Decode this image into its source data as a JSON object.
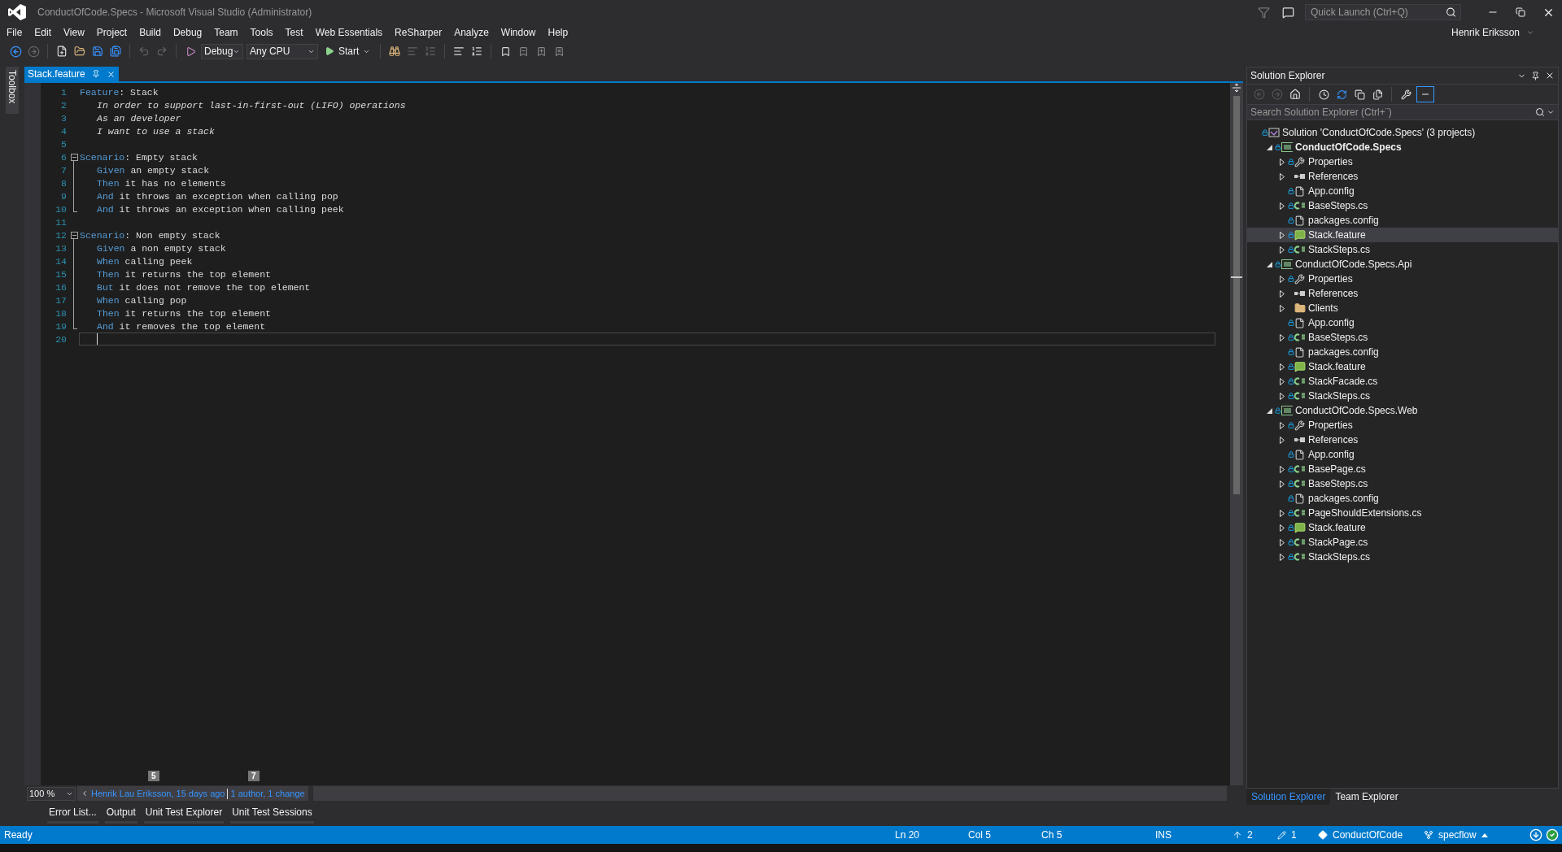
{
  "window": {
    "title": "ConductOfCode.Specs - Microsoft Visual Studio (Administrator)",
    "quick_launch": {
      "placeholder": "Quick Launch (Ctrl+Q)"
    },
    "user": "Henrik Eriksson"
  },
  "menu": [
    "File",
    "Edit",
    "View",
    "Project",
    "Build",
    "Debug",
    "Team",
    "Tools",
    "Test",
    "Web Essentials",
    "ReSharper",
    "Analyze",
    "Window",
    "Help"
  ],
  "toolbar": {
    "configuration": "Debug",
    "platform": "Any CPU",
    "start": "Start"
  },
  "toolbox_label": "Toolbox",
  "document_tabs": [
    {
      "label": "Stack.feature",
      "selected": true
    }
  ],
  "editor": {
    "blocks": [
      {
        "kind": "plain",
        "lines": [
          {
            "number": "1",
            "kind": "header",
            "current": false,
            "tokens": [
              {
                "kind": "keyword",
                "text": "Feature"
              },
              {
                "kind": "plain",
                "text": ": Stack"
              }
            ]
          },
          {
            "number": "2",
            "kind": "step",
            "current": false,
            "tokens": [
              {
                "kind": "description",
                "text": "In order to support last-in-first-out (LIFO) operations"
              }
            ]
          },
          {
            "number": "3",
            "kind": "step",
            "current": false,
            "tokens": [
              {
                "kind": "description",
                "text": "As an developer"
              }
            ]
          },
          {
            "number": "4",
            "kind": "step",
            "current": false,
            "tokens": [
              {
                "kind": "description",
                "text": "I want to use a stack"
              }
            ]
          },
          {
            "number": "5",
            "kind": "blank",
            "current": false
          }
        ]
      },
      {
        "kind": "scenario",
        "expanded": true,
        "lines": [
          {
            "number": "6",
            "kind": "header",
            "current": false,
            "tokens": [
              {
                "kind": "keyword",
                "text": "Scenario"
              },
              {
                "kind": "plain",
                "text": ": Empty stack"
              }
            ]
          },
          {
            "number": "7",
            "kind": "step",
            "current": false,
            "tokens": [
              {
                "kind": "keyword",
                "text": "Given"
              },
              {
                "kind": "plain",
                "text": " an empty stack"
              }
            ]
          },
          {
            "number": "8",
            "kind": "step",
            "current": false,
            "tokens": [
              {
                "kind": "keyword",
                "text": "Then"
              },
              {
                "kind": "plain",
                "text": " it has no elements"
              }
            ]
          },
          {
            "number": "9",
            "kind": "step",
            "current": false,
            "tokens": [
              {
                "kind": "keyword",
                "text": "And"
              },
              {
                "kind": "plain",
                "text": " it throws an exception when calling pop"
              }
            ]
          },
          {
            "number": "10",
            "kind": "step",
            "current": false,
            "tokens": [
              {
                "kind": "keyword",
                "text": "And"
              },
              {
                "kind": "plain",
                "text": " it throws an exception when calling peek"
              }
            ]
          }
        ]
      },
      {
        "kind": "plain",
        "lines": [
          {
            "number": "11",
            "kind": "blank",
            "current": false
          }
        ]
      },
      {
        "kind": "scenario",
        "expanded": true,
        "lines": [
          {
            "number": "12",
            "kind": "header",
            "current": false,
            "tokens": [
              {
                "kind": "keyword",
                "text": "Scenario"
              },
              {
                "kind": "plain",
                "text": ": Non empty stack"
              }
            ]
          },
          {
            "number": "13",
            "kind": "step",
            "current": false,
            "tokens": [
              {
                "kind": "keyword",
                "text": "Given"
              },
              {
                "kind": "plain",
                "text": " a non empty stack"
              }
            ]
          },
          {
            "number": "14",
            "kind": "step",
            "current": false,
            "tokens": [
              {
                "kind": "keyword",
                "text": "When"
              },
              {
                "kind": "plain",
                "text": " calling peek"
              }
            ]
          },
          {
            "number": "15",
            "kind": "step",
            "current": false,
            "tokens": [
              {
                "kind": "keyword",
                "text": "Then"
              },
              {
                "kind": "plain",
                "text": " it returns the top element"
              }
            ]
          },
          {
            "number": "16",
            "kind": "step",
            "current": false,
            "tokens": [
              {
                "kind": "keyword",
                "text": "But"
              },
              {
                "kind": "plain",
                "text": " it does not remove the top element"
              }
            ]
          },
          {
            "number": "17",
            "kind": "step",
            "current": false,
            "tokens": [
              {
                "kind": "keyword",
                "text": "When"
              },
              {
                "kind": "plain",
                "text": " calling pop"
              }
            ]
          },
          {
            "number": "18",
            "kind": "step",
            "current": false,
            "tokens": [
              {
                "kind": "keyword",
                "text": "Then"
              },
              {
                "kind": "plain",
                "text": " it returns the top element"
              }
            ]
          },
          {
            "number": "19",
            "kind": "step",
            "current": false,
            "tokens": [
              {
                "kind": "keyword",
                "text": "And"
              },
              {
                "kind": "plain",
                "text": " it removes the top element"
              }
            ]
          }
        ]
      },
      {
        "kind": "plain",
        "lines": [
          {
            "number": "20",
            "kind": "step",
            "current": true
          }
        ]
      }
    ],
    "zoom": "100 %",
    "codelens": {
      "author": "Henrik Lau Eriksson, 15 days ago",
      "changes": "1 author, 1 change",
      "keytips": [
        "5",
        "7"
      ]
    }
  },
  "tool_tabs": [
    "Error List...",
    "Output",
    "Unit Test Explorer",
    "Unit Test Sessions"
  ],
  "solution_explorer": {
    "title": "Solution Explorer",
    "search": {
      "placeholder": "Search Solution Explorer (Ctrl+¨)"
    },
    "tree": [
      {
        "label": "Solution 'ConductOfCode.Specs' (3 projects)",
        "kind": "solution",
        "locked": true,
        "startup": false,
        "selected": false,
        "children": [
          {
            "label": "ConductOfCode.Specs",
            "kind": "project",
            "expanded": true,
            "locked": true,
            "startup": true,
            "selected": false,
            "children": [
              {
                "label": "Properties",
                "kind": "properties",
                "expanded": false,
                "locked": true,
                "startup": false,
                "selected": false
              },
              {
                "label": "References",
                "kind": "references",
                "expanded": false,
                "locked": false,
                "startup": false,
                "selected": false
              },
              {
                "label": "App.config",
                "kind": "config",
                "locked": true,
                "startup": false,
                "selected": false
              },
              {
                "label": "BaseSteps.cs",
                "kind": "csharp",
                "expanded": false,
                "locked": true,
                "startup": false,
                "selected": false
              },
              {
                "label": "packages.config",
                "kind": "config",
                "locked": true,
                "startup": false,
                "selected": false
              },
              {
                "label": "Stack.feature",
                "kind": "feature",
                "expanded": false,
                "locked": true,
                "startup": false,
                "selected": true
              },
              {
                "label": "StackSteps.cs",
                "kind": "csharp",
                "expanded": false,
                "locked": true,
                "startup": false,
                "selected": false
              }
            ]
          },
          {
            "label": "ConductOfCode.Specs.Api",
            "kind": "project",
            "expanded": true,
            "locked": true,
            "startup": false,
            "selected": false,
            "children": [
              {
                "label": "Properties",
                "kind": "properties",
                "expanded": false,
                "locked": true,
                "startup": false,
                "selected": false
              },
              {
                "label": "References",
                "kind": "references",
                "expanded": false,
                "locked": false,
                "startup": false,
                "selected": false
              },
              {
                "label": "Clients",
                "kind": "folder",
                "expanded": false,
                "locked": false,
                "startup": false,
                "selected": false
              },
              {
                "label": "App.config",
                "kind": "config",
                "locked": true,
                "startup": false,
                "selected": false
              },
              {
                "label": "BaseSteps.cs",
                "kind": "csharp",
                "expanded": false,
                "locked": true,
                "startup": false,
                "selected": false
              },
              {
                "label": "packages.config",
                "kind": "config",
                "locked": true,
                "startup": false,
                "selected": false
              },
              {
                "label": "Stack.feature",
                "kind": "feature",
                "expanded": false,
                "locked": true,
                "startup": false,
                "selected": false
              },
              {
                "label": "StackFacade.cs",
                "kind": "csharp",
                "expanded": false,
                "locked": true,
                "startup": false,
                "selected": false
              },
              {
                "label": "StackSteps.cs",
                "kind": "csharp",
                "expanded": false,
                "locked": true,
                "startup": false,
                "selected": false
              }
            ]
          },
          {
            "label": "ConductOfCode.Specs.Web",
            "kind": "project",
            "expanded": true,
            "locked": true,
            "startup": false,
            "selected": false,
            "children": [
              {
                "label": "Properties",
                "kind": "properties",
                "expanded": false,
                "locked": true,
                "startup": false,
                "selected": false
              },
              {
                "label": "References",
                "kind": "references",
                "expanded": false,
                "locked": false,
                "startup": false,
                "selected": false
              },
              {
                "label": "App.config",
                "kind": "config",
                "locked": true,
                "startup": false,
                "selected": false
              },
              {
                "label": "BasePage.cs",
                "kind": "csharp",
                "expanded": false,
                "locked": true,
                "startup": false,
                "selected": false
              },
              {
                "label": "BaseSteps.cs",
                "kind": "csharp",
                "expanded": false,
                "locked": true,
                "startup": false,
                "selected": false
              },
              {
                "label": "packages.config",
                "kind": "config",
                "locked": true,
                "startup": false,
                "selected": false
              },
              {
                "label": "PageShouldExtensions.cs",
                "kind": "csharp",
                "expanded": false,
                "locked": true,
                "startup": false,
                "selected": false
              },
              {
                "label": "Stack.feature",
                "kind": "feature",
                "expanded": false,
                "locked": true,
                "startup": false,
                "selected": false
              },
              {
                "label": "StackPage.cs",
                "kind": "csharp",
                "expanded": false,
                "locked": true,
                "startup": false,
                "selected": false
              },
              {
                "label": "StackSteps.cs",
                "kind": "csharp",
                "expanded": false,
                "locked": true,
                "startup": false,
                "selected": false
              }
            ]
          }
        ]
      }
    ],
    "tabs": [
      {
        "label": "Solution Explorer",
        "selected": true
      },
      {
        "label": "Team Explorer",
        "selected": false
      }
    ]
  },
  "status_bar": {
    "message": "Ready",
    "line": "Ln 20",
    "column": "Col 5",
    "char": "Ch 5",
    "mode": "INS",
    "outgoing": "2",
    "pending": "1",
    "repository": "ConductOfCode",
    "branch": "specflow"
  }
}
